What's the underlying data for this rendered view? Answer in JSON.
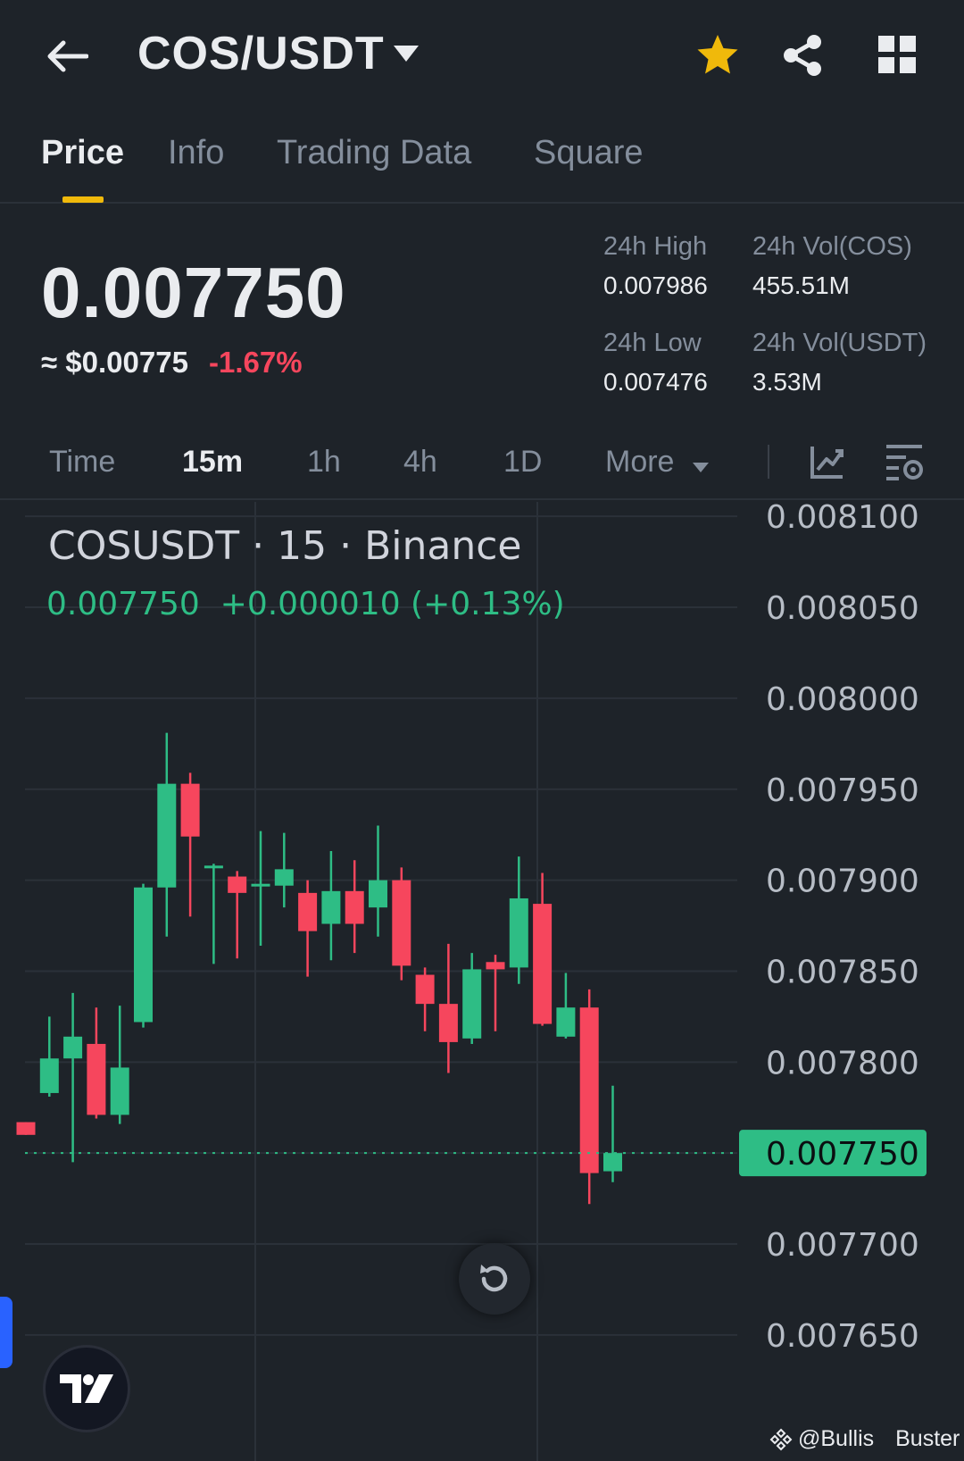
{
  "header": {
    "pair": "COS/USDT",
    "icons": [
      "back-arrow-icon",
      "caret-down-icon",
      "star-icon",
      "share-icon",
      "grid-icon"
    ],
    "star_color": "#f0b90b"
  },
  "tabs": [
    {
      "label": "Price",
      "active": true
    },
    {
      "label": "Info",
      "active": false
    },
    {
      "label": "Trading Data",
      "active": false
    },
    {
      "label": "Square",
      "active": false
    }
  ],
  "ticker": {
    "last_price": "0.007750",
    "usd_approx": "≈ $0.00775",
    "change_pct": "-1.67%",
    "high_label": "24h High",
    "high_value": "0.007986",
    "vol_base_label": "24h Vol(COS)",
    "vol_base_value": "455.51M",
    "low_label": "24h Low",
    "low_value": "0.007476",
    "vol_quote_label": "24h Vol(USDT)",
    "vol_quote_value": "3.53M"
  },
  "intervals": {
    "items": [
      "Time",
      "15m",
      "1h",
      "4h",
      "1D",
      "More"
    ],
    "active": "15m",
    "icons": [
      "indicator-icon",
      "chart-settings-icon"
    ]
  },
  "chart": {
    "legend_title": "COSUSDT · 15 · Binance",
    "legend_price": "0.007750",
    "legend_change": "+0.000010 (+0.13%)",
    "current_price_label": "0.007750",
    "up_color": "#2ebd85",
    "down_color": "#f6465d"
  },
  "chart_data": {
    "type": "candlestick",
    "symbol": "COSUSDT",
    "interval": "15",
    "exchange": "Binance",
    "y_ticks": [
      "0.008100",
      "0.008050",
      "0.008000",
      "0.007950",
      "0.007900",
      "0.007850",
      "0.007800",
      "0.007750",
      "0.007700",
      "0.007650"
    ],
    "ylim": [
      0.00762,
      0.008105
    ],
    "current_price": 0.00775,
    "candles": [
      {
        "o": 0.007767,
        "h": 0.007767,
        "l": 0.00776,
        "c": 0.00776
      },
      {
        "o": 0.007783,
        "h": 0.007825,
        "l": 0.007781,
        "c": 0.007802
      },
      {
        "o": 0.007802,
        "h": 0.007838,
        "l": 0.007745,
        "c": 0.007814
      },
      {
        "o": 0.00781,
        "h": 0.00783,
        "l": 0.007769,
        "c": 0.007771
      },
      {
        "o": 0.007771,
        "h": 0.007831,
        "l": 0.007766,
        "c": 0.007797
      },
      {
        "o": 0.007822,
        "h": 0.007898,
        "l": 0.007819,
        "c": 0.007896
      },
      {
        "o": 0.007896,
        "h": 0.007981,
        "l": 0.007869,
        "c": 0.007953
      },
      {
        "o": 0.007953,
        "h": 0.007959,
        "l": 0.00788,
        "c": 0.007924
      },
      {
        "o": 0.007907,
        "h": 0.007909,
        "l": 0.007854,
        "c": 0.007908
      },
      {
        "o": 0.007902,
        "h": 0.007905,
        "l": 0.007857,
        "c": 0.007893
      },
      {
        "o": 0.007898,
        "h": 0.007927,
        "l": 0.007864,
        "c": 0.007898
      },
      {
        "o": 0.007897,
        "h": 0.007926,
        "l": 0.007885,
        "c": 0.007906
      },
      {
        "o": 0.007893,
        "h": 0.0079,
        "l": 0.007847,
        "c": 0.007872
      },
      {
        "o": 0.007876,
        "h": 0.007916,
        "l": 0.007856,
        "c": 0.007894
      },
      {
        "o": 0.007894,
        "h": 0.007911,
        "l": 0.00786,
        "c": 0.007876
      },
      {
        "o": 0.007885,
        "h": 0.00793,
        "l": 0.007869,
        "c": 0.0079
      },
      {
        "o": 0.0079,
        "h": 0.007907,
        "l": 0.007845,
        "c": 0.007853
      },
      {
        "o": 0.007848,
        "h": 0.007852,
        "l": 0.007817,
        "c": 0.007832
      },
      {
        "o": 0.007832,
        "h": 0.007865,
        "l": 0.007794,
        "c": 0.007811
      },
      {
        "o": 0.007813,
        "h": 0.00786,
        "l": 0.00781,
        "c": 0.007851
      },
      {
        "o": 0.007855,
        "h": 0.007859,
        "l": 0.007817,
        "c": 0.007851
      },
      {
        "o": 0.007852,
        "h": 0.007913,
        "l": 0.007843,
        "c": 0.00789
      },
      {
        "o": 0.007887,
        "h": 0.007904,
        "l": 0.00782,
        "c": 0.007821
      },
      {
        "o": 0.007814,
        "h": 0.007849,
        "l": 0.007813,
        "c": 0.00783
      },
      {
        "o": 0.00783,
        "h": 0.00784,
        "l": 0.007722,
        "c": 0.007739
      },
      {
        "o": 0.00774,
        "h": 0.007787,
        "l": 0.007734,
        "c": 0.00775
      }
    ]
  },
  "watermark": {
    "handle": "@Bullis",
    "name": "Buster"
  }
}
